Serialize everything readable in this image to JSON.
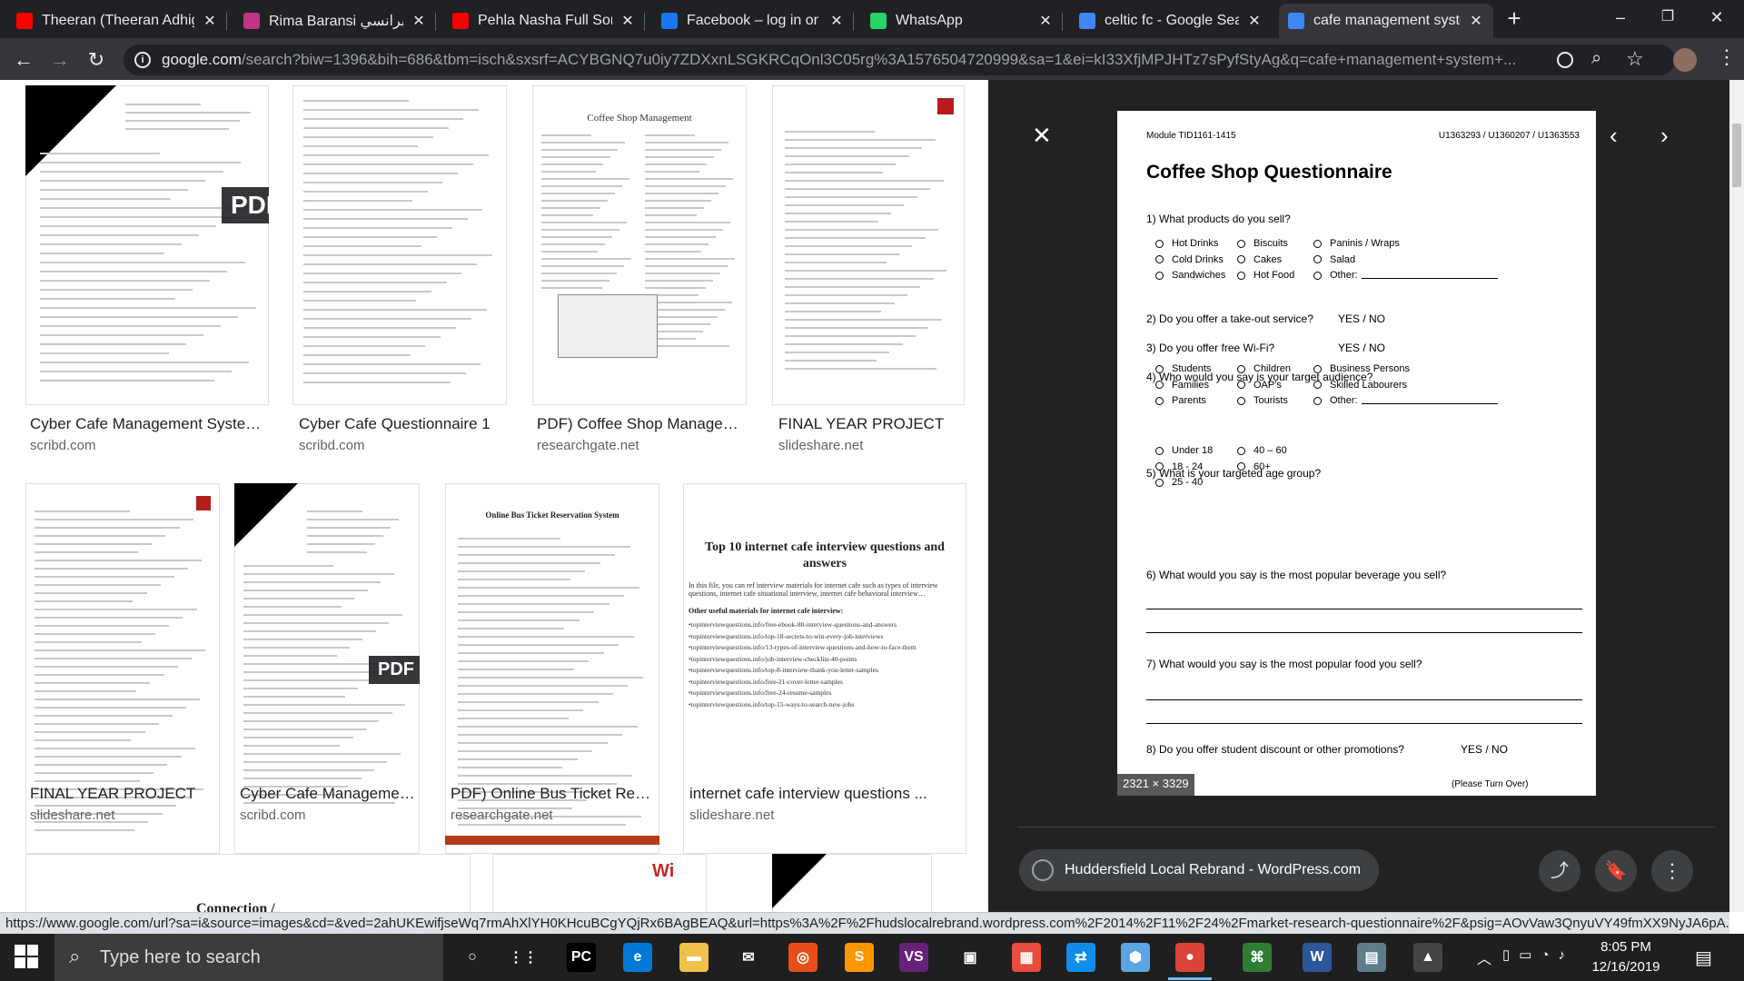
{
  "tabs": [
    {
      "title": "Theeran (Theeran Adhigaram Ondru)",
      "favicon": "youtube-icon",
      "color": "#ff0000"
    },
    {
      "title": "Rima Baransi ريما برانسي",
      "favicon": "instagram-icon",
      "color": "#c13584"
    },
    {
      "title": "Pehla Nasha Full Song",
      "favicon": "youtube-icon",
      "color": "#ff0000"
    },
    {
      "title": "Facebook – log in or sign up",
      "favicon": "facebook-icon",
      "color": "#1877f2"
    },
    {
      "title": "WhatsApp",
      "favicon": "whatsapp-icon",
      "color": "#25d366"
    },
    {
      "title": "celtic fc - Google Search",
      "favicon": "google-icon",
      "color": "#4285f4"
    },
    {
      "title": "cafe management system",
      "favicon": "google-icon",
      "color": "#4285f4"
    }
  ],
  "url": {
    "domain": "google.com",
    "path": "/search?biw=1396&bih=686&tbm=isch&sxsrf=ACYBGNQ7u0iy7ZDXxnLSGKRCqOnl3C05rg%3A1576504720999&sa=1&ei=kI33XfjMPJHTz7sPyfStyAg&q=cafe+management+system+..."
  },
  "results_row1": [
    {
      "title": "Cyber Cafe Management Syste…",
      "source": "scribd.com",
      "badge": "PDF"
    },
    {
      "title": "Cyber Cafe Questionnaire 1",
      "source": "scribd.com"
    },
    {
      "title": "PDF) Coffee Shop Manage…",
      "source": "researchgate.net",
      "inner_title": "Coffee Shop Management"
    },
    {
      "title": "FINAL YEAR PROJECT",
      "source": "slideshare.net"
    }
  ],
  "results_row2": [
    {
      "title": "FINAL YEAR PROJECT",
      "source": "slideshare.net"
    },
    {
      "title": "Cyber Cafe Manageme…",
      "source": "scribd.com",
      "badge": "PDF"
    },
    {
      "title": "PDF) Online Bus Ticket Re…",
      "source": "researchgate.net",
      "inner_title": "Online Bus Ticket Reservation System"
    },
    {
      "title": "internet cafe interview questions ...",
      "source": "slideshare.net",
      "inner_title": "Top 10 internet cafe interview questions and answers",
      "inner_lines": [
        "•topinterviewquestions.info/free-ebook-80-interview-questions-and-answers",
        "•topinterviewquestions.info/top-18-secrets-to-win-every-job-interviews",
        "•topinterviewquestions.info/13-types-of-interview-questions-and-how-to-face-them",
        "•topinterviewquestions.info/job-interview-checklist-40-points",
        "•topinterviewquestions.info/top-8-interview-thank-you-letter-samples",
        "•topinterviewquestions.info/free-21-cover-letter-samples",
        "•topinterviewquestions.info/free-24-resume-samples",
        "•topinterviewquestions.info/top-15-ways-to-search-new-jobs"
      ],
      "inner_intro": "In this file, you can ref interview materials for internet cafe such as types of interview questions, internet cafe situational interview, internet cafe behavioral interview…",
      "inner_sub": "Other useful materials for internet cafe interview:"
    }
  ],
  "row3_partial": {
    "caption": "Connection /"
  },
  "preview": {
    "doc": {
      "module": "Module TID1161-1415",
      "ids": "U1363293 / U1360207 / U1363553",
      "title": "Coffee Shop Questionnaire",
      "q1": "1) What products do you sell?",
      "q1_options": [
        "Hot Drinks",
        "Biscuits",
        "Paninis / Wraps",
        "Cold Drinks",
        "Cakes",
        "Salad",
        "Sandwiches",
        "Hot Food",
        "Other:"
      ],
      "q2": "2) Do you offer a take-out service?",
      "q2_ans": "YES / NO",
      "q3": "3) Do you offer free Wi-Fi?",
      "q3_ans": "YES / NO",
      "q4": "4) Who would you say is your target audience?",
      "q4_options": [
        "Students",
        "Children",
        "Business Persons",
        "Families",
        "OAP's",
        "Skilled Labourers",
        "Parents",
        "Tourists",
        "Other:"
      ],
      "q5": "5) What is your targeted age group?",
      "q5_options": [
        "Under 18",
        "40 – 60",
        "18 - 24",
        "60+",
        "25 - 40"
      ],
      "q6": "6) What would you say is the most popular beverage you sell?",
      "q7": "7) What would you say is the most popular food you sell?",
      "q8": "8) Do you offer student discount or other promotions?",
      "q8_ans": "YES / NO",
      "footer": "(Please Turn Over)"
    },
    "dimensions": "2321 × 3329",
    "source_title": "Huddersfield Local Rebrand - WordPress.com"
  },
  "status_url": "https://www.google.com/url?sa=i&source=images&cd=&ved=2ahUKEwifjseWq7rmAhXlYH0KHcuBCgYQjRx6BAgBEAQ&url=https%3A%2F%2Fhudslocalrebrand.wordpress.com%2F2014%2F11%2F24%2Fmarket-research-questionnaire%2F&psig=AOvVaw3QnyuVY49fmXX9NyJA6pA...",
  "taskbar": {
    "search_placeholder": "Type here to search",
    "time": "8:05 PM",
    "date": "12/16/2019"
  }
}
